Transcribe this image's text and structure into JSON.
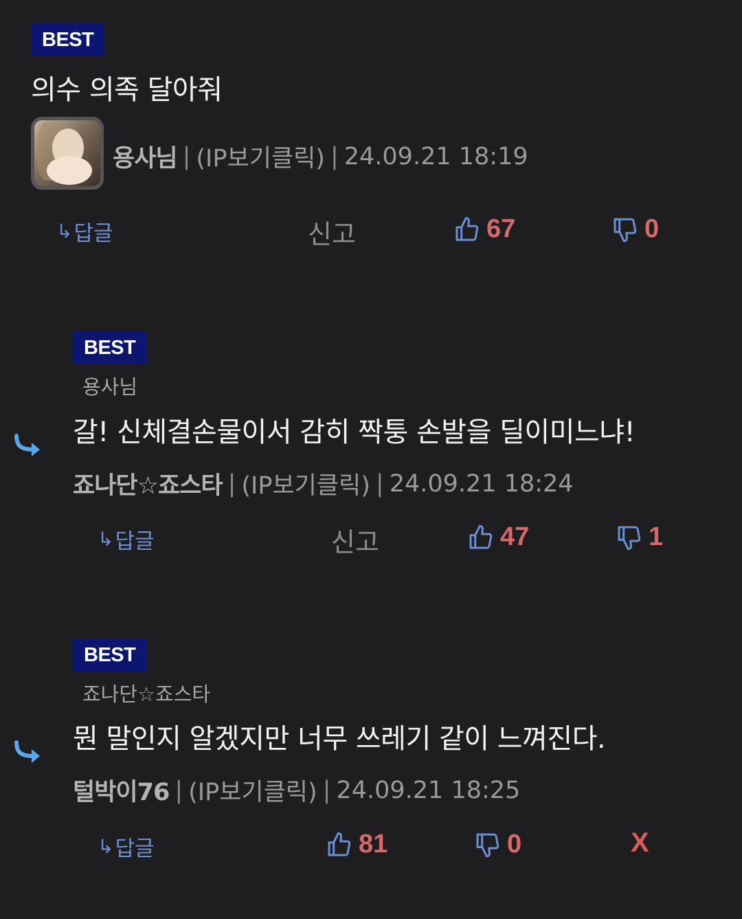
{
  "comments": [
    {
      "badge": "BEST",
      "text": "의수 의족 달아줘",
      "author": "용사님",
      "ip": "(IP보기클릭)",
      "timestamp": "24.09.21 18:19",
      "reply_label": "답글",
      "report_label": "신고",
      "likes": "67",
      "dislikes": "0"
    },
    {
      "badge": "BEST",
      "reply_to": "용사님",
      "text": "갈! 신체결손물이서 감히 짝퉁 손발을 딜이미느냐!",
      "author": "죠나단☆죠스타",
      "ip": "(IP보기클릭)",
      "timestamp": "24.09.21 18:24",
      "reply_label": "답글",
      "report_label": "신고",
      "likes": "47",
      "dislikes": "1"
    },
    {
      "badge": "BEST",
      "reply_to": "죠나단☆죠스타",
      "text": "뭔 말인지 알겠지만 너무 쓰레기 같이 느껴진다.",
      "author": "털박이76",
      "ip": "(IP보기클릭)",
      "timestamp": "24.09.21 18:25",
      "reply_label": "답글",
      "likes": "81",
      "dislikes": "0",
      "delete_label": "X"
    }
  ],
  "colors": {
    "background": "#1e1e20",
    "badge": "#0c1670",
    "reply_accent": "#6b8fd0",
    "vote_count": "#d46a6a",
    "reply_arrow": "#5aa6e6"
  },
  "icons": {
    "reply_arrow": "reply-arrow-icon",
    "thumbs_up": "thumbs-up-icon",
    "thumbs_down": "thumbs-down-icon"
  }
}
